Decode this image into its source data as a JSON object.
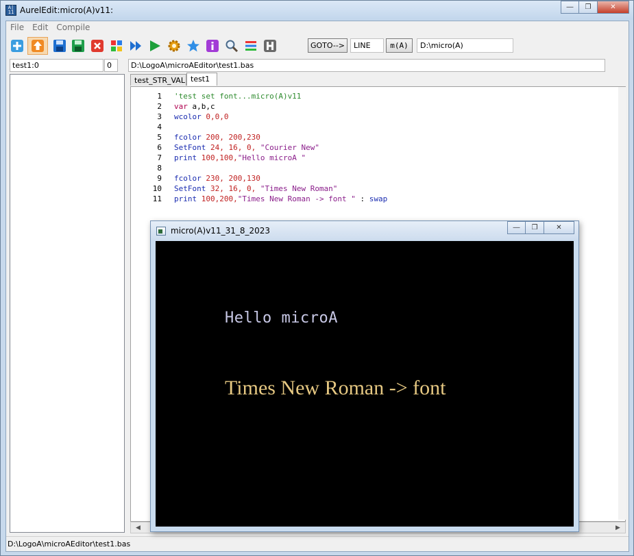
{
  "window": {
    "title": "AurelEdit:micro(A)v11:",
    "app_icon_text": "A|\n11"
  },
  "menu": [
    "File",
    "Edit",
    "Compile"
  ],
  "toolbar": {
    "icons": [
      "new-icon",
      "open-icon",
      "save-icon",
      "save-as-icon",
      "close-icon",
      "run-colors-icon",
      "fast-forward-icon",
      "run-icon",
      "settings-gear-icon",
      "star-icon",
      "info-icon",
      "search-icon",
      "list-icon",
      "h-icon"
    ],
    "goto_label": "GOTO-->",
    "line_value": "LINE",
    "ma_label": "m(A)",
    "path_value": "D:\\micro(A)"
  },
  "row2": {
    "function_field": "test1:0",
    "number_field": "0",
    "file_path": "D:\\LogoA\\microAEditor\\test1.bas"
  },
  "tabs": [
    {
      "label": "test_STR_VAL",
      "active": false
    },
    {
      "label": "test1",
      "active": true
    }
  ],
  "code": [
    {
      "n": "1",
      "tokens": [
        {
          "t": "'test set font...micro(A)v11",
          "c": "comment"
        }
      ]
    },
    {
      "n": "2",
      "tokens": [
        {
          "t": "var",
          "c": "kw"
        },
        {
          "t": " a,b,c",
          "c": "src"
        }
      ]
    },
    {
      "n": "3",
      "tokens": [
        {
          "t": "wcolor",
          "c": "fn"
        },
        {
          "t": " 0,0,0",
          "c": "num"
        }
      ]
    },
    {
      "n": "4",
      "tokens": []
    },
    {
      "n": "5",
      "tokens": [
        {
          "t": "fcolor",
          "c": "fn"
        },
        {
          "t": " 200, 200,230",
          "c": "num"
        }
      ]
    },
    {
      "n": "6",
      "tokens": [
        {
          "t": "SetFont",
          "c": "fn"
        },
        {
          "t": " 24, 16, 0, ",
          "c": "num"
        },
        {
          "t": "\"Courier New\"",
          "c": "str"
        }
      ]
    },
    {
      "n": "7",
      "tokens": [
        {
          "t": "print",
          "c": "fn"
        },
        {
          "t": " 100,100,",
          "c": "num"
        },
        {
          "t": "\"Hello microA \"",
          "c": "str"
        }
      ]
    },
    {
      "n": "8",
      "tokens": []
    },
    {
      "n": "9",
      "tokens": [
        {
          "t": "fcolor",
          "c": "fn"
        },
        {
          "t": " 230, 200,130",
          "c": "num"
        }
      ]
    },
    {
      "n": "10",
      "tokens": [
        {
          "t": "SetFont",
          "c": "fn"
        },
        {
          "t": " 32, 16, 0, ",
          "c": "num"
        },
        {
          "t": "\"Times New Roman\"",
          "c": "str"
        }
      ]
    },
    {
      "n": "11",
      "tokens": [
        {
          "t": "print",
          "c": "fn"
        },
        {
          "t": " 100,200,",
          "c": "num"
        },
        {
          "t": "\"Times New Roman -> font \"",
          "c": "str"
        },
        {
          "t": " : ",
          "c": "src"
        },
        {
          "t": "swap",
          "c": "fn"
        }
      ]
    }
  ],
  "status": "D:\\LogoA\\microAEditor\\test1.bas",
  "child_window": {
    "title": "micro(A)v11_31_8_2023",
    "hello_text": "Hello microA",
    "tnr_text": "Times New Roman -> font",
    "hello_color": "#c8c8e6",
    "tnr_color": "#e6c882",
    "canvas_bg": "#000000"
  }
}
